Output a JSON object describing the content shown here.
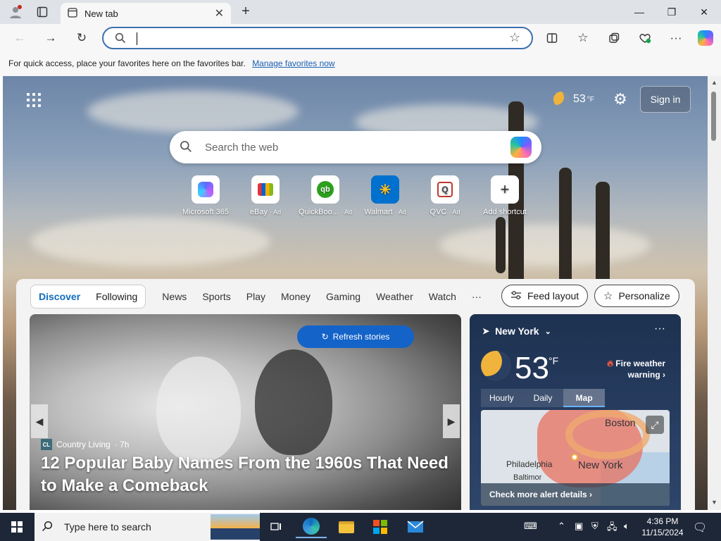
{
  "browser": {
    "tab_title": "New tab",
    "address_placeholder": "",
    "favorites_hint": "For quick access, place your favorites here on the favorites bar.",
    "favorites_link": "Manage favorites now"
  },
  "newtab": {
    "weather_temp": "53",
    "weather_unit": "°F",
    "sign_in": "Sign in",
    "search_placeholder": "Search the web",
    "shortcuts": [
      {
        "name": "Microsoft 365",
        "ad": ""
      },
      {
        "name": "eBay",
        "ad": "· Ad"
      },
      {
        "name": "QuickBoo...",
        "ad": "· Ad"
      },
      {
        "name": "Walmart",
        "ad": "· Ad"
      },
      {
        "name": "QVC",
        "ad": "· Ad"
      },
      {
        "name": "Add shortcut",
        "ad": ""
      }
    ]
  },
  "feed": {
    "tabs_primary": [
      "Discover",
      "Following"
    ],
    "tabs": [
      "News",
      "Sports",
      "Play",
      "Money",
      "Gaming",
      "Weather",
      "Watch",
      "···"
    ],
    "feed_layout": "Feed layout",
    "personalize": "Personalize",
    "refresh": "Refresh stories",
    "hero": {
      "source_logo": "CL",
      "source": "Country Living",
      "age": "· 7h",
      "title": "12 Popular Baby Names From the 1960s That Need to Make a Comeback"
    }
  },
  "weather_card": {
    "location": "New York",
    "more": "···",
    "temp": "53",
    "unit": "°F",
    "alert": "Fire weather warning",
    "tabs": [
      "Hourly",
      "Daily",
      "Map"
    ],
    "active_tab": "Map",
    "cities": [
      "Boston",
      "Philadelphia",
      "New York",
      "Baltimor"
    ],
    "check_alerts": "Check more alert details ›"
  },
  "taskbar": {
    "search_placeholder": "Type here to search",
    "time": "4:36 PM",
    "date": "11/15/2024"
  },
  "colors": {
    "accent": "#0f6cbd",
    "refresh_button": "#1463c9",
    "taskbar": "#1e2738"
  }
}
